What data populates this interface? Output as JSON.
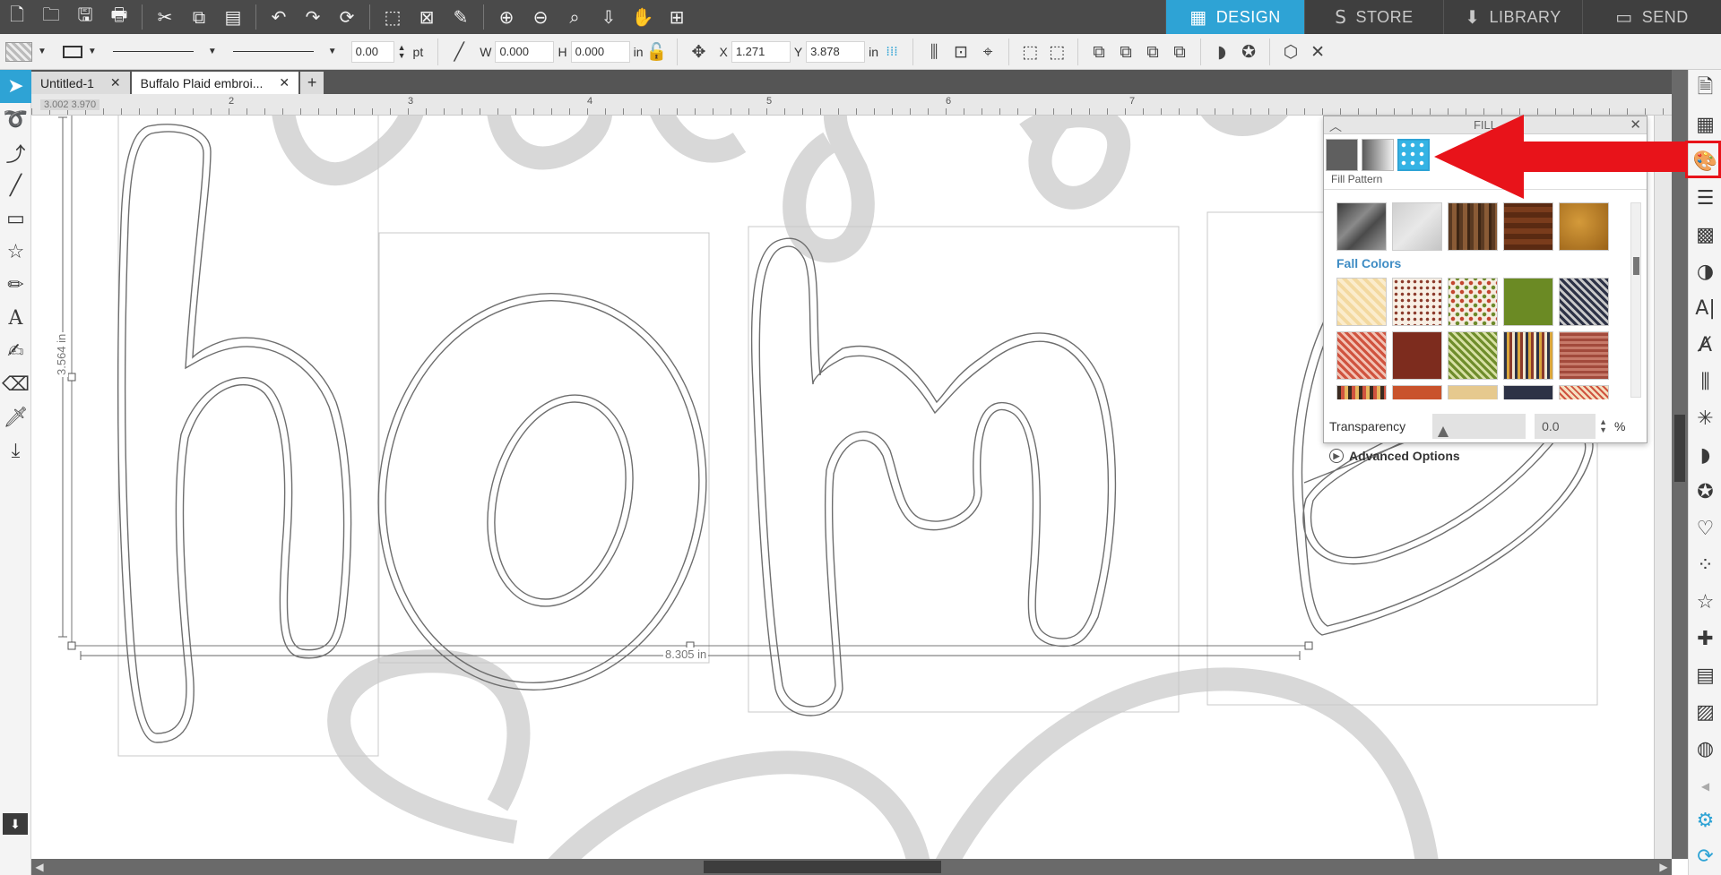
{
  "nav": {
    "tabs": [
      {
        "label": "DESIGN",
        "icon": "grid-icon",
        "glyph": "▦"
      },
      {
        "label": "STORE",
        "icon": "store-s-icon",
        "glyph": "S"
      },
      {
        "label": "LIBRARY",
        "icon": "library-download-icon",
        "glyph": "⬇"
      },
      {
        "label": "SEND",
        "icon": "cutter-icon",
        "glyph": "▭"
      }
    ]
  },
  "toolbar": {
    "icons": [
      "new-document-icon",
      "open-folder-icon",
      "save-icon",
      "print-icon",
      "cut-icon",
      "copy-icon",
      "paste-icon",
      "undo-icon",
      "redo-icon",
      "refresh-icon",
      "select-all-icon",
      "deselect-icon",
      "edit-points-icon",
      "zoom-in-icon",
      "zoom-out-icon",
      "zoom-to-fit-icon",
      "move-down-icon",
      "pan-hand-icon",
      "grid-plus-icon"
    ],
    "glyphs": [
      "🗋",
      "🗀",
      "💾",
      "🖶",
      "✂",
      "⧉",
      "📋",
      "↶",
      "↷",
      "⟳",
      "⬚",
      "⊠",
      "⚙",
      "⊕",
      "⊖",
      "⌕",
      "⇩",
      "✋",
      "⊞"
    ]
  },
  "props": {
    "stroke_width": "0.00",
    "stroke_unit": "pt",
    "w_label": "W",
    "w_value": "0.000",
    "h_label": "H",
    "h_value": "0.000",
    "size_unit": "in",
    "x_label": "X",
    "x_value": "1.271",
    "y_label": "Y",
    "y_value": "3.878",
    "pos_unit": "in"
  },
  "doc_tabs": [
    {
      "label": "Untitled-1"
    },
    {
      "label": "Buffalo Plaid embroi..."
    }
  ],
  "ruler": {
    "readout": "3.002   3.970",
    "numbers": [
      "2",
      "3",
      "4",
      "5",
      "6",
      "7"
    ]
  },
  "canvas": {
    "width_label": "8.305 in",
    "height_label": "3.564 in"
  },
  "fill_panel": {
    "title": "FILL",
    "subtitle": "Fill Pattern",
    "category": "Fall Colors",
    "transparency_label": "Transparency",
    "transparency_value": "0.0",
    "transparency_unit": "%",
    "advanced_label": "Advanced Options"
  }
}
